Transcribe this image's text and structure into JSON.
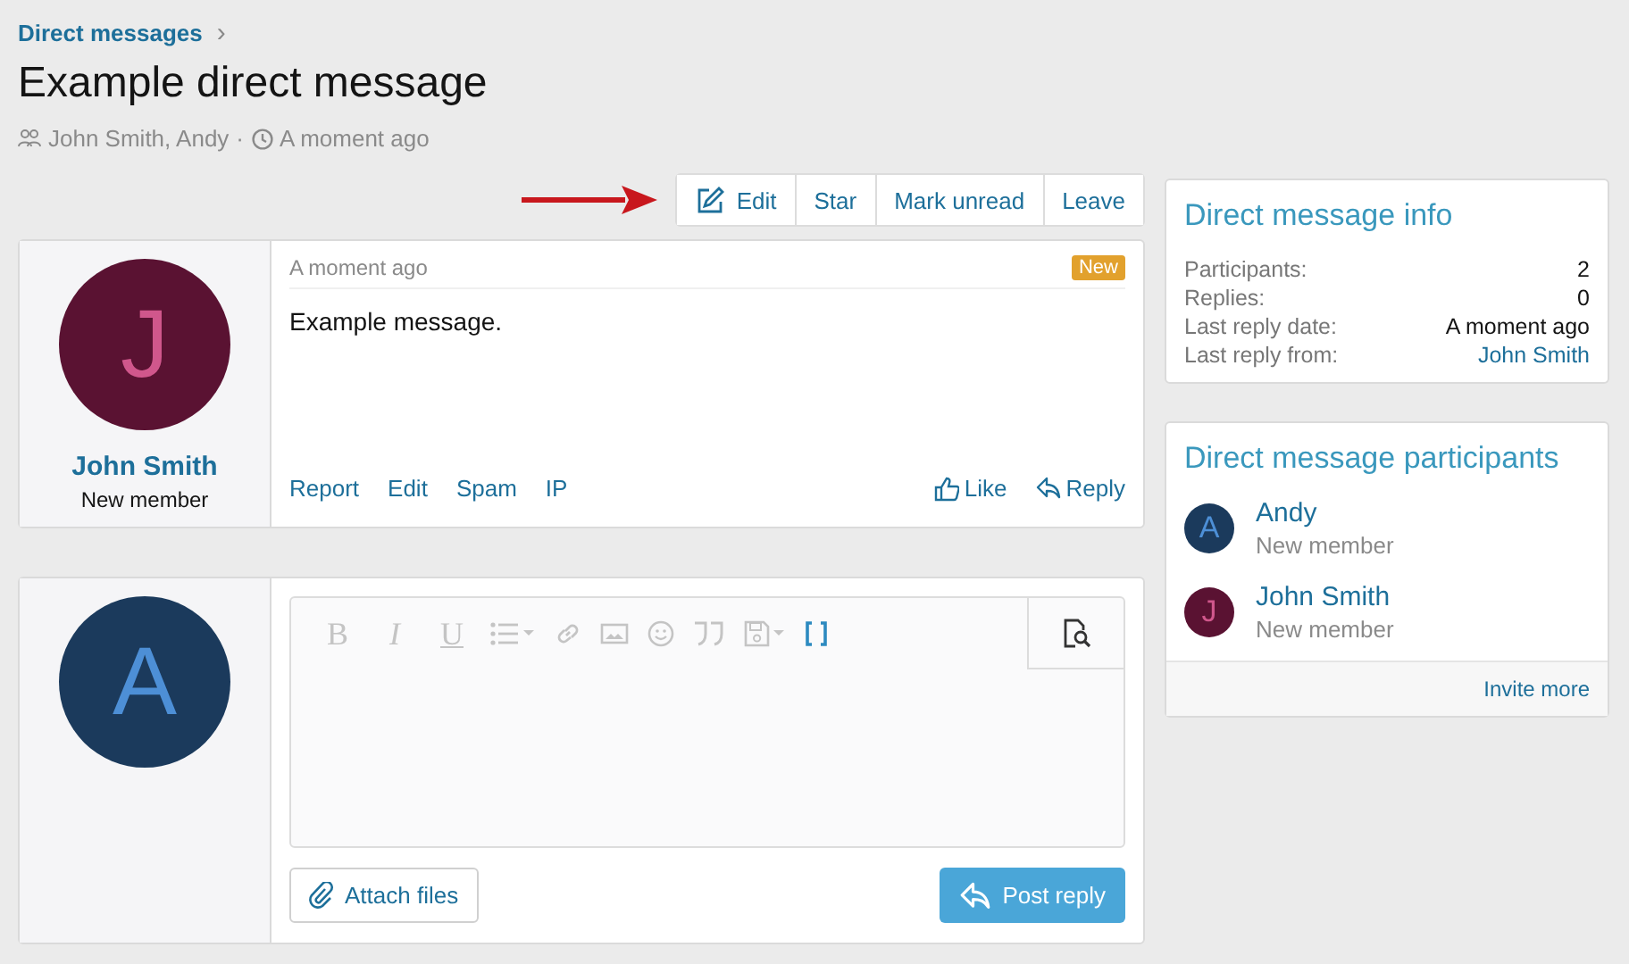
{
  "breadcrumb": {
    "label": "Direct messages",
    "separator": "›"
  },
  "title": "Example direct message",
  "meta": {
    "participants": "John Smith, Andy",
    "separator": "·",
    "time": "A moment ago"
  },
  "actions": [
    {
      "label": "Edit",
      "kind": "edit"
    },
    {
      "label": "Star",
      "kind": "plain"
    },
    {
      "label": "Mark unread",
      "kind": "plain"
    },
    {
      "label": "Leave",
      "kind": "plain"
    }
  ],
  "message": {
    "author": "John Smith",
    "role": "New member",
    "avatar_letter": "J",
    "color": "#5a1232",
    "time": "A moment ago",
    "badge": "New",
    "body": "Example message.",
    "links": [
      "Report",
      "Edit",
      "Spam",
      "IP"
    ],
    "like": "Like",
    "reply": "Reply"
  },
  "composer": {
    "avatar_letter": "A",
    "color": "#1b3a5c",
    "toolbar": [
      {
        "kind": "bold",
        "glyph": "B"
      },
      {
        "kind": "italic",
        "glyph": "I"
      },
      {
        "kind": "underline",
        "glyph": "U"
      },
      {
        "kind": "list"
      },
      {
        "kind": "link"
      },
      {
        "kind": "image"
      },
      {
        "kind": "smiley"
      },
      {
        "kind": "quote"
      },
      {
        "kind": "save"
      },
      {
        "kind": "bbcode"
      }
    ],
    "attach": "Attach files",
    "post": "Post reply"
  },
  "info": {
    "title": "Direct message info",
    "rows": [
      {
        "label": "Participants:",
        "value": "2",
        "link": false
      },
      {
        "label": "Replies:",
        "value": "0",
        "link": false
      },
      {
        "label": "Last reply date:",
        "value": "A moment ago",
        "link": false
      },
      {
        "label": "Last reply from:",
        "value": "John Smith",
        "link": true
      }
    ]
  },
  "participants": {
    "title": "Direct message participants",
    "items": [
      {
        "name": "Andy",
        "role": "New member",
        "avatar_letter": "A",
        "color": "#1b3a5c"
      },
      {
        "name": "John Smith",
        "role": "New member",
        "avatar_letter": "J",
        "color": "#5a1232"
      }
    ],
    "footer": "Invite more"
  }
}
